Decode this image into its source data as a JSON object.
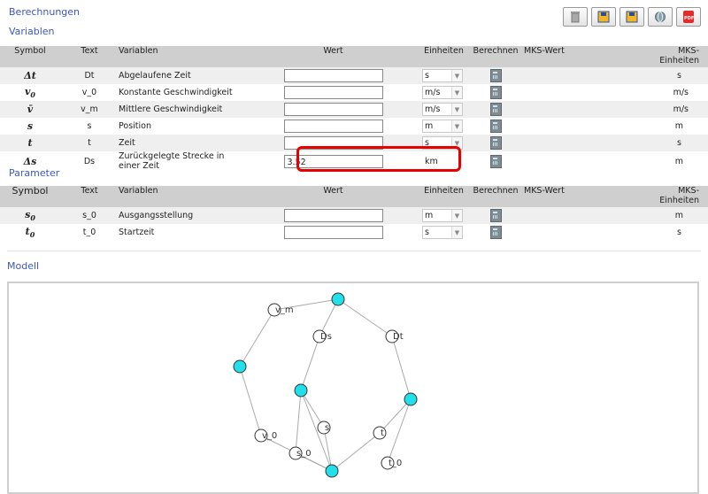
{
  "header": {
    "berechnungen": "Berechnungen",
    "variablen": "Variablen",
    "parameter": "Parameter",
    "modell": "Modell"
  },
  "toolbar": [
    {
      "name": "trash-icon"
    },
    {
      "name": "save-model-icon"
    },
    {
      "name": "save-model-alt-icon"
    },
    {
      "name": "settings-globe-icon"
    },
    {
      "name": "pdf-icon",
      "label": "PDF"
    }
  ],
  "variables_table": {
    "headers": {
      "symbol": "Symbol",
      "text": "Text",
      "variablen": "Variablen",
      "wert": "Wert",
      "einheiten": "Einheiten",
      "berechnen": "Berechnen",
      "mks_wert": "MKS-Wert",
      "mks_einheiten": "MKS-\nEinheiten"
    },
    "rows": [
      {
        "symbol": "Δt",
        "text": "Dt",
        "desc": "Abgelaufene Zeit",
        "value": "",
        "unit": "s",
        "mks_unit": "s"
      },
      {
        "symbol": "v",
        "symbol_sub": "0",
        "text": "v_0",
        "desc": "Konstante Geschwindigkeit",
        "value": "",
        "unit": "m/s",
        "mks_unit": "m/s"
      },
      {
        "symbol": "v̄",
        "text": "v_m",
        "desc": "Mittlere Geschwindigkeit",
        "value": "",
        "unit": "m/s",
        "mks_unit": "m/s"
      },
      {
        "symbol": "s",
        "text": "s",
        "desc": "Position",
        "value": "",
        "unit": "m",
        "mks_unit": "m"
      },
      {
        "symbol": "t",
        "text": "t",
        "desc": "Zeit",
        "value": "",
        "unit": "s",
        "mks_unit": "s"
      },
      {
        "symbol": "Δs",
        "text": "Ds",
        "desc": "Zurückgelegte Strecke in einer Zeit",
        "value": "3.52",
        "unit": "km",
        "mks_unit": "m"
      }
    ]
  },
  "parameter_table": {
    "headers": {
      "symbol": "Symbol",
      "text": "Text",
      "variablen": "Variablen",
      "wert": "Wert",
      "einheiten": "Einheiten",
      "berechnen": "Berechnen",
      "mks_wert": "MKS-Wert",
      "mks_einheiten": "MKS-\nEinheiten"
    },
    "rows": [
      {
        "symbol": "s",
        "symbol_sub": "0",
        "text": "s_0",
        "desc": "Ausgangsstellung",
        "value": "",
        "unit": "m",
        "mks_unit": "m"
      },
      {
        "symbol": "t",
        "symbol_sub": "0",
        "text": "t_0",
        "desc": "Startzeit",
        "value": "",
        "unit": "s",
        "mks_unit": "s"
      }
    ]
  },
  "model_graph": {
    "nodes": [
      {
        "id": "v_m",
        "label": "v_m",
        "type": "variable"
      },
      {
        "id": "c1",
        "label": "",
        "type": "equation"
      },
      {
        "id": "Ds",
        "label": "Ds",
        "type": "variable"
      },
      {
        "id": "Dt",
        "label": "Dt",
        "type": "variable"
      },
      {
        "id": "c2",
        "label": "",
        "type": "equation"
      },
      {
        "id": "c3",
        "label": "",
        "type": "equation"
      },
      {
        "id": "c4",
        "label": "",
        "type": "equation"
      },
      {
        "id": "s",
        "label": "s",
        "type": "variable"
      },
      {
        "id": "t",
        "label": "t",
        "type": "variable"
      },
      {
        "id": "v_0",
        "label": "v_0",
        "type": "variable"
      },
      {
        "id": "s_0",
        "label": "s_0",
        "type": "variable"
      },
      {
        "id": "t_0",
        "label": "t_0",
        "type": "variable"
      },
      {
        "id": "c5",
        "label": "",
        "type": "equation"
      }
    ],
    "edges": [
      [
        "v_m",
        "c1"
      ],
      [
        "c1",
        "Ds"
      ],
      [
        "c1",
        "Dt"
      ],
      [
        "v_m",
        "c2"
      ],
      [
        "c2",
        "v_0"
      ],
      [
        "Ds",
        "c3"
      ],
      [
        "c3",
        "s"
      ],
      [
        "c3",
        "s_0"
      ],
      [
        "Dt",
        "c4"
      ],
      [
        "c4",
        "t_0"
      ],
      [
        "s",
        "c5"
      ],
      [
        "s_0",
        "c5"
      ],
      [
        "v_0",
        "c5"
      ],
      [
        "t",
        "c5"
      ],
      [
        "t",
        "c4"
      ],
      [
        "c3",
        "c5"
      ]
    ],
    "colors": {
      "equation": "#22e0ea",
      "variable": "#ffffff",
      "edge": "#aaaaaa"
    }
  }
}
